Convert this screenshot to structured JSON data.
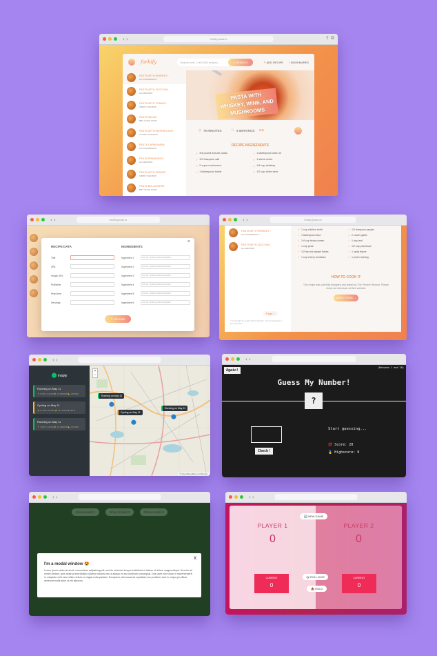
{
  "colors": {
    "background": "#a586f0",
    "forkify_accent": "#f38e4c",
    "game_bg": "#1b1b1b",
    "modal_bg": "#2c5530",
    "pig_btn": "#ef2b58"
  },
  "forkify": {
    "url": "forkify.jonas.io",
    "logo": "forkify",
    "search_placeholder": "Search over 1,000,000 recipes...",
    "search_button": "SEARCH",
    "add_recipe": "ADD RECIPE",
    "bookmarks": "BOOKMARKS",
    "results": [
      {
        "title": "PASTA WITH WHISKEY...",
        "publisher": "101 COOKBOOKS"
      },
      {
        "title": "PASTA WITH ZUCCHINI",
        "publisher": "ALL RECIPES"
      },
      {
        "title": "PASTA WITH TOMATO...",
        "publisher": "SIMPLY RECIPES"
      },
      {
        "title": "PASTA SALAD",
        "publisher": "BBC GOOD FOOD"
      },
      {
        "title": "PASTA WITH MUSHROOMS",
        "publisher": "CLOSET COOKING"
      },
      {
        "title": "PASTA CARBONARA",
        "publisher": "101 COOKBOOKS"
      },
      {
        "title": "PASTA PRIMAVERA",
        "publisher": "ALL RECIPES"
      },
      {
        "title": "PASTA WITH SHRIMP",
        "publisher": "SIMPLY RECIPES"
      },
      {
        "title": "PASTA BOLOGNESE",
        "publisher": "BBC GOOD FOOD"
      }
    ],
    "recipe_title": "PASTA WITH WHISKEY, WINE, AND MUSHROOMS",
    "minutes": "75 MINUTES",
    "servings": "4 SERVINGS",
    "ingredients_heading": "RECIPE INGREDIENTS",
    "ingredients": [
      "3/4 pound bow-tie pasta",
      "1 tablespoon olive oil",
      "1/2 teaspoon salt",
      "1 sliced onion",
      "2 cups mushrooms",
      "1/4 cup whiskey",
      "1 tablespoon butter",
      "1/2 cup white wine"
    ]
  },
  "upload": {
    "data_heading": "RECIPE DATA",
    "ing_heading": "INGREDIENTS",
    "fields": [
      "Title",
      "URL",
      "Image URL",
      "Publisher",
      "Prep time",
      "Servings"
    ],
    "ing_fields": [
      "Ingredient 1",
      "Ingredient 2",
      "Ingredient 3",
      "Ingredient 4",
      "Ingredient 5",
      "Ingredient 6"
    ],
    "ing_placeholder": "Format: 'Quantity,Unit,Description'",
    "upload_button": "UPLOAD",
    "close": "×"
  },
  "howto": {
    "results": [
      {
        "title": "PASTA WITH WHISKEY...",
        "publisher": "101 COOKBOOKS"
      },
      {
        "title": "PASTA WITH ZUCCHINI",
        "publisher": "ALL RECIPES"
      }
    ],
    "page_label": "Page 1",
    "copyright": "© Copyright by Jonas Schmedtmann. Use for learning or your portfolio.",
    "ingredients": [
      "1 cup chicken broth",
      "1/2 teaspoon pepper",
      "1 tablespoon flour",
      "2 cloves garlic",
      "1/4 cup heavy cream",
      "1 bay leaf",
      "1 cup peas",
      "1/2 cup parmesan",
      "1/2 tsp red pepper flakes",
      "1 sprig thyme",
      "1 cup cherry tomatoes",
      "1 pinch nutmeg"
    ],
    "heading": "HOW TO COOK IT",
    "text": "This recipe was carefully designed and tested by The Pioneer Woman. Please check out directions at their website.",
    "button": "DIRECTIONS"
  },
  "mapty": {
    "logo": "mapty",
    "workouts": [
      {
        "title": "Running on May 11",
        "stats": "🏃 5 KM  ⏱ 24 MIN  ⚡ 4.8 MIN/KM  🦶 178 SPM"
      },
      {
        "title": "Cycling on May 11",
        "stats": "🚴 27 KM  ⏱ 95 MIN  ⚡ 16.4 KM/H  ⛰ 523 M"
      },
      {
        "title": "Running on May 11",
        "stats": "🏃 3 KM  ⏱ 14 MIN  ⚡ 4.6 MIN/KM  🦶 170 SPM"
      }
    ],
    "popups": [
      "Running on May 11",
      "Cycling on May 11",
      "Running on May 11"
    ],
    "attribution": "© OpenStreetMap contributors"
  },
  "guess": {
    "again": "Again!",
    "range": "(Between 1 and 20)",
    "title": "Guess My Number!",
    "secret": "?",
    "check": "Check!",
    "message": "Start guessing...",
    "score_label": "Score:",
    "score": "20",
    "highscore_label": "Highscore:",
    "highscore": "0"
  },
  "modal": {
    "buttons": [
      "Show modal 1",
      "Show modal 2",
      "Show modal 3"
    ],
    "title": "I'm a modal window 😍",
    "close": "x",
    "text": "Lorem ipsum dolor sit amet, consectetur adipisicing elit, sed do eiusmod tempor incididunt ut labore et dolore magna aliqua. Ut enim ad minim veniam, quis nostrud exercitation ullamco laboris nisi ut aliquip ex ea commodo consequat. Duis aute irure dolor in reprehenderit in voluptate velit esse cillum dolore eu fugiat nulla pariatur. Excepteur sint occaecat cupidatat non proident, sunt in culpa qui officia deserunt mollit anim id est laborum."
  },
  "pig": {
    "new_game": "🔄 NEW GAME",
    "player1": "PLAYER 1",
    "player2": "PLAYER 2",
    "score1": "0",
    "score2": "0",
    "current_label": "CURRENT",
    "current1": "0",
    "current2": "0",
    "roll": "🎲 ROLL DICE",
    "hold": "📥 HOLD"
  }
}
